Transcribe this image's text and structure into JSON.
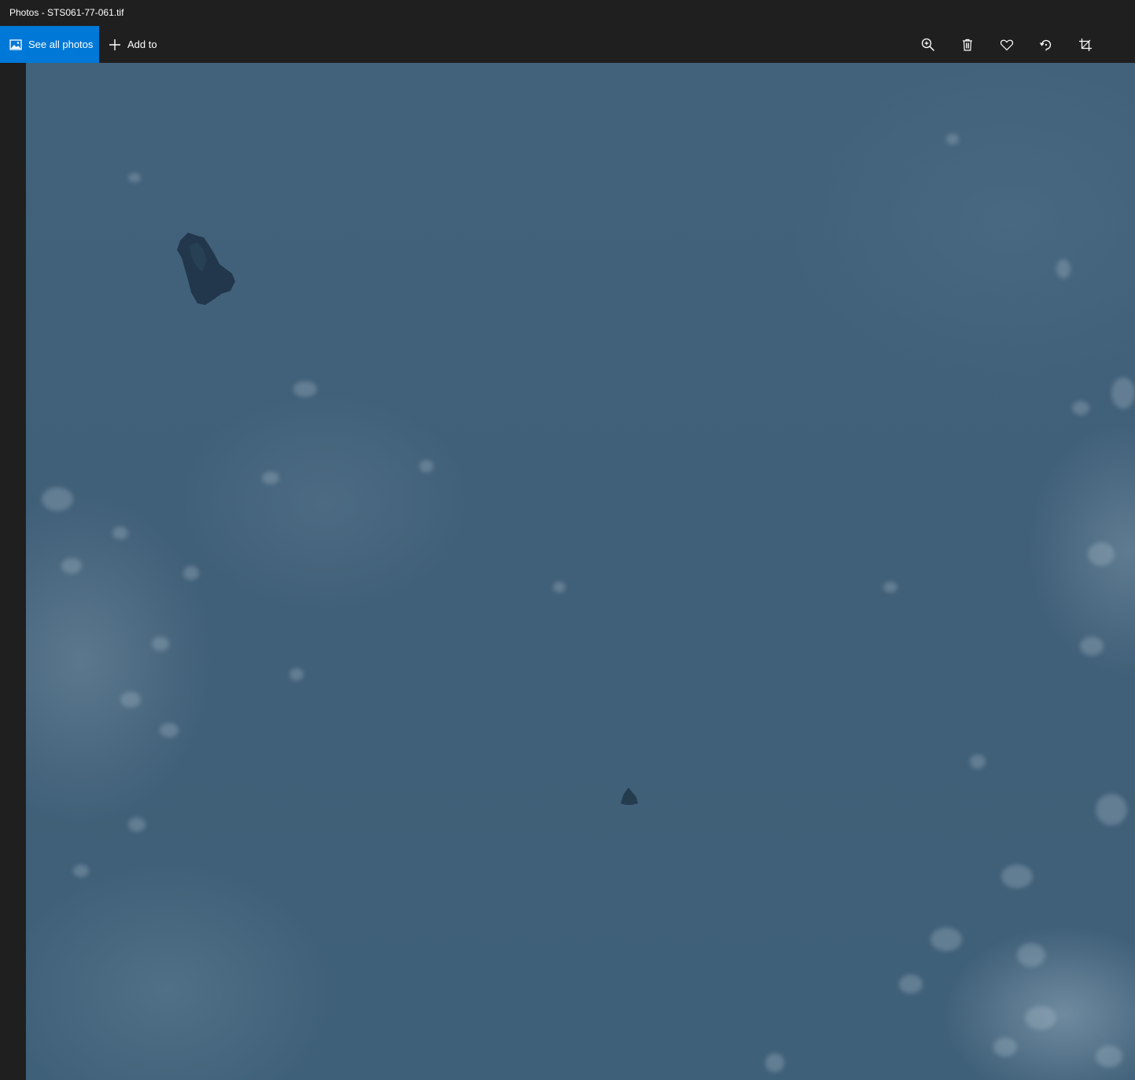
{
  "window": {
    "title": "Photos - STS061-77-061.tif"
  },
  "toolbar": {
    "see_all_label": "See all photos",
    "add_to_label": "Add to",
    "tools": [
      {
        "name": "zoom",
        "icon": "zoom-in-icon"
      },
      {
        "name": "delete",
        "icon": "trash-icon"
      },
      {
        "name": "favorite",
        "icon": "heart-icon"
      },
      {
        "name": "rotate",
        "icon": "rotate-icon"
      },
      {
        "name": "crop",
        "icon": "crop-icon"
      }
    ]
  },
  "colors": {
    "accent": "#0078d7",
    "chrome": "#1f1f1f",
    "photo_base": "#41617a"
  }
}
